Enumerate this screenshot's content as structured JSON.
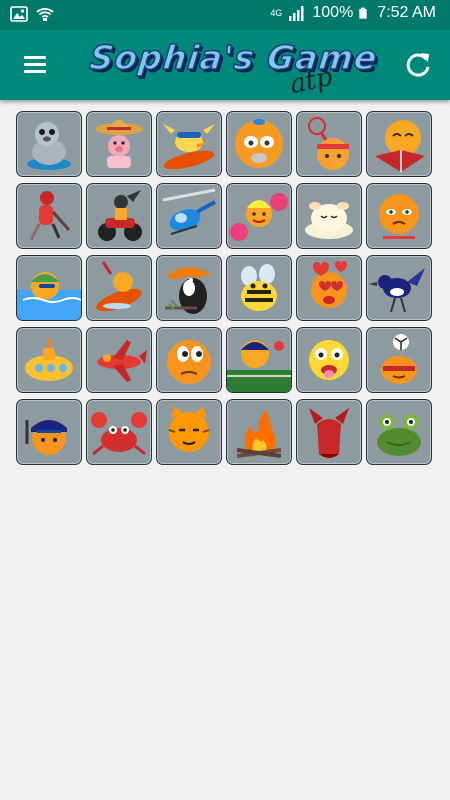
{
  "status_bar": {
    "battery": "100%",
    "time": "7:52 AM",
    "network": "4G",
    "icons": [
      "image-icon",
      "wifi-icon",
      "signal-icon",
      "battery-icon"
    ]
  },
  "app_bar": {
    "title": "Sophia's Game",
    "subtitle": "atp",
    "menu_icon": "menu-icon",
    "refresh_icon": "refresh-icon",
    "color": "#00897b"
  },
  "grid": {
    "columns": 6,
    "rows": 5,
    "tile_background": "#8d9aa0",
    "tiles": [
      "seal",
      "mexican-pig",
      "surfer-chick",
      "girl-face",
      "tennis-player",
      "reading-face",
      "hockey-player",
      "motorbike-rider",
      "helicopter",
      "cheerleader",
      "sleepy-bun",
      "teary-face",
      "swimmer",
      "jet-ski",
      "toucan",
      "bee",
      "love-face",
      "magpie",
      "submarine",
      "airplane",
      "thinking-face",
      "ping-pong-player",
      "silly-face",
      "juggling-face",
      "police-face",
      "crab",
      "tiger",
      "campfire",
      "devil",
      "frog"
    ]
  }
}
